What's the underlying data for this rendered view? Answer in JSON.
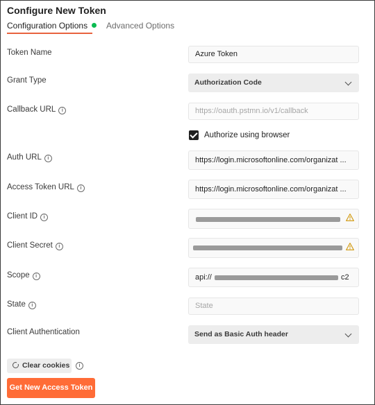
{
  "dialog": {
    "title": "Configure New Token",
    "tabs": [
      {
        "label": "Configuration Options",
        "active": true
      },
      {
        "label": "Advanced Options",
        "active": false
      }
    ]
  },
  "form": {
    "token_name": {
      "label": "Token Name",
      "value": "Azure Token"
    },
    "grant_type": {
      "label": "Grant Type",
      "value": "Authorization Code"
    },
    "callback_url": {
      "label": "Callback URL",
      "placeholder": "https://oauth.pstmn.io/v1/callback"
    },
    "authorize_browser": {
      "label": "Authorize using browser",
      "checked": true
    },
    "auth_url": {
      "label": "Auth URL",
      "value": "https://login.microsoftonline.com/organizat ..."
    },
    "access_token_url": {
      "label": "Access Token URL",
      "value": "https://login.microsoftonline.com/organizat ..."
    },
    "client_id": {
      "label": "Client ID",
      "value_redacted": true
    },
    "client_secret": {
      "label": "Client Secret",
      "value_redacted": true
    },
    "scope": {
      "label": "Scope",
      "value_prefix": "api://",
      "value_suffix": "c2"
    },
    "state": {
      "label": "State",
      "placeholder": "State"
    },
    "client_authentication": {
      "label": "Client Authentication",
      "value": "Send as Basic Auth header"
    }
  },
  "actions": {
    "clear_cookies": "Clear cookies",
    "get_token": "Get New Access Token"
  },
  "colors": {
    "accent": "#ff6c37",
    "tab_underline": "#e8623e",
    "status_dot": "#0cbb52",
    "warning": "#d4a020"
  },
  "icons": {
    "info": "info-icon",
    "chevron": "chevron-down-icon",
    "warning": "warning-icon",
    "cookie": "cookie-icon",
    "check": "checkbox-check-icon"
  }
}
